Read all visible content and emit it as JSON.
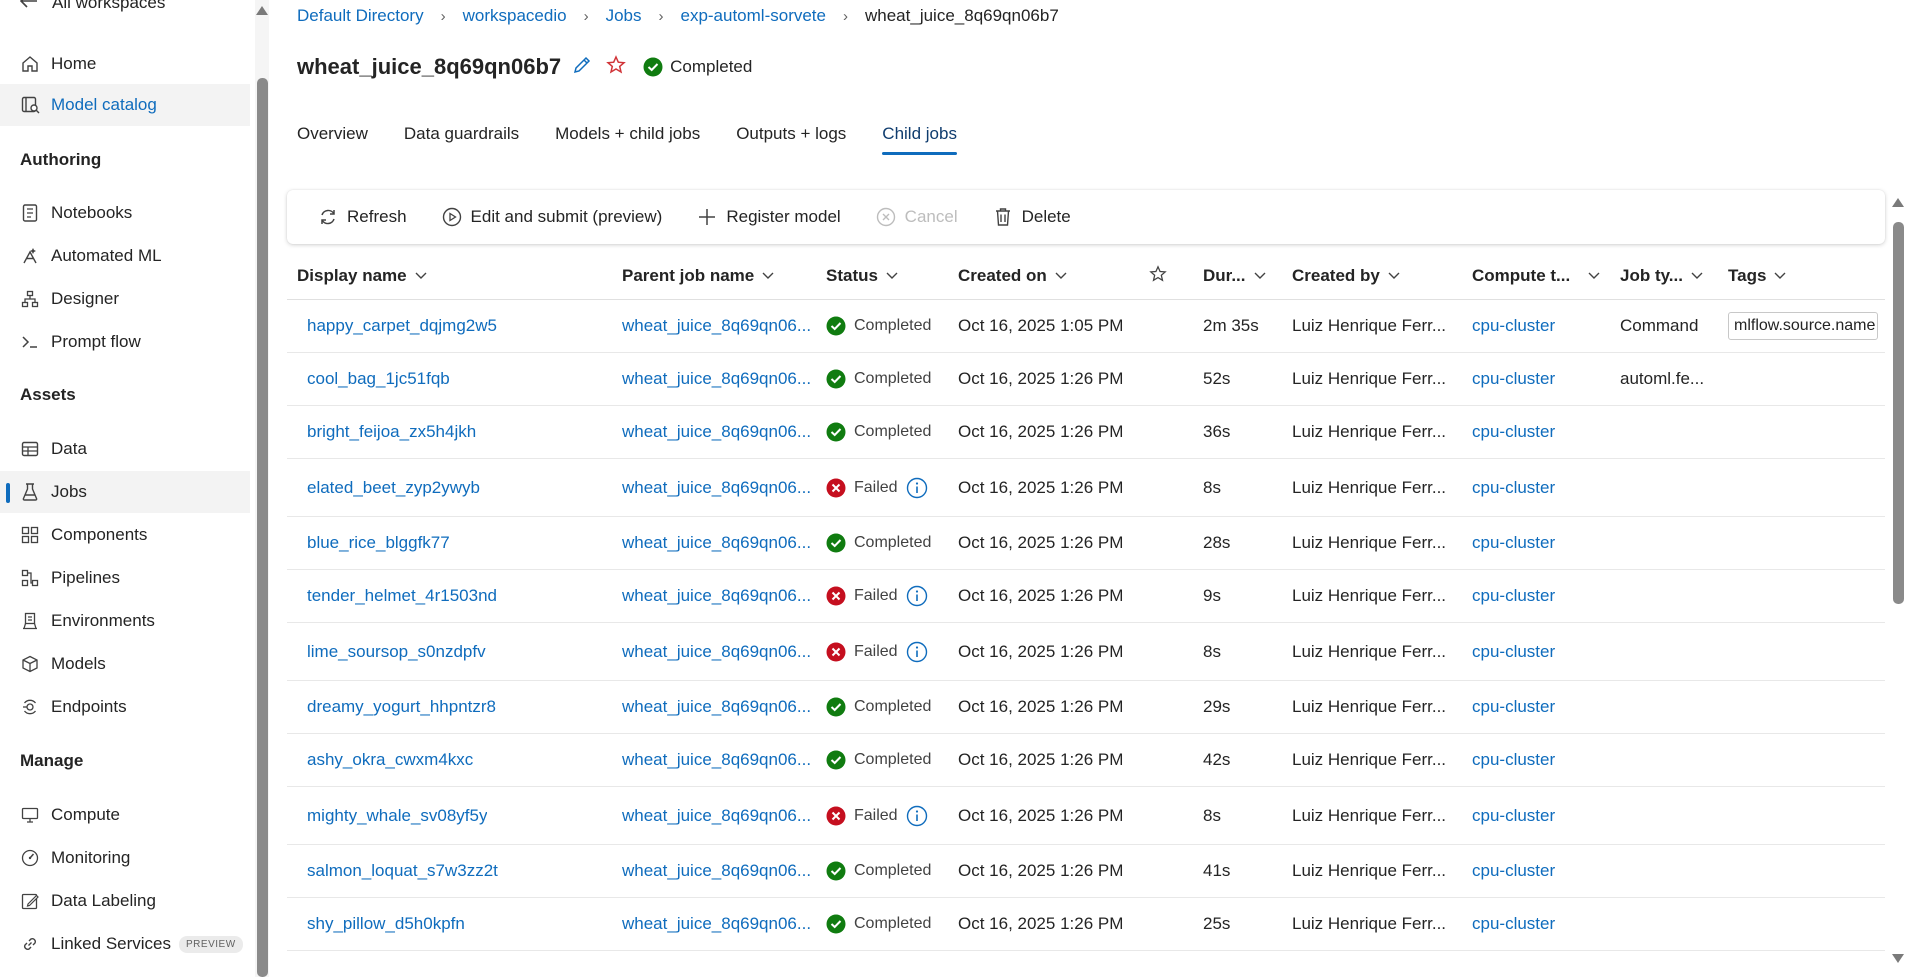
{
  "sidebar": {
    "back_label": "All workspaces",
    "items": [
      {
        "label": "Home",
        "icon": "home-icon"
      },
      {
        "label": "Model catalog",
        "icon": "catalog-icon"
      },
      {
        "label": "Notebooks",
        "icon": "notebook-icon"
      },
      {
        "label": "Automated ML",
        "icon": "automl-icon"
      },
      {
        "label": "Designer",
        "icon": "designer-icon"
      },
      {
        "label": "Prompt flow",
        "icon": "prompt-flow-icon"
      },
      {
        "label": "Data",
        "icon": "data-icon"
      },
      {
        "label": "Jobs",
        "icon": "flask-icon"
      },
      {
        "label": "Components",
        "icon": "components-icon"
      },
      {
        "label": "Pipelines",
        "icon": "pipelines-icon"
      },
      {
        "label": "Environments",
        "icon": "environments-icon"
      },
      {
        "label": "Models",
        "icon": "cube-icon"
      },
      {
        "label": "Endpoints",
        "icon": "endpoints-icon"
      },
      {
        "label": "Compute",
        "icon": "compute-icon"
      },
      {
        "label": "Monitoring",
        "icon": "monitoring-icon"
      },
      {
        "label": "Data Labeling",
        "icon": "labeling-icon"
      },
      {
        "label": "Linked Services",
        "icon": "link-icon",
        "badge": "PREVIEW"
      }
    ],
    "sections": {
      "authoring": "Authoring",
      "assets": "Assets",
      "manage": "Manage"
    }
  },
  "breadcrumb": {
    "items": [
      "Default Directory",
      "workspacedio",
      "Jobs",
      "exp-automl-sorvete"
    ],
    "current": "wheat_juice_8q69qn06b7"
  },
  "header": {
    "title": "wheat_juice_8q69qn06b7",
    "status": "Completed"
  },
  "tabs": [
    "Overview",
    "Data guardrails",
    "Models + child jobs",
    "Outputs + logs",
    "Child jobs"
  ],
  "active_tab": "Child jobs",
  "toolbar": {
    "refresh": "Refresh",
    "edit_submit": "Edit and submit (preview)",
    "register": "Register model",
    "cancel": "Cancel",
    "delete": "Delete"
  },
  "table": {
    "columns": {
      "display_name": "Display name",
      "parent_job": "Parent job name",
      "status": "Status",
      "created_on": "Created on",
      "duration": "Dur...",
      "created_by": "Created by",
      "compute": "Compute t...",
      "job_type": "Job ty...",
      "tags": "Tags"
    },
    "rows": [
      {
        "name": "happy_carpet_dqjmg2w5",
        "parent": "wheat_juice_8q69qn06...",
        "status": "Completed",
        "created": "Oct 16, 2025 1:05 PM",
        "duration": "2m 35s",
        "created_by": "Luiz Henrique Ferr...",
        "compute": "cpu-cluster",
        "job_type": "Command",
        "tags": "mlflow.source.name"
      },
      {
        "name": "cool_bag_1jc51fqb",
        "parent": "wheat_juice_8q69qn06...",
        "status": "Completed",
        "created": "Oct 16, 2025 1:26 PM",
        "duration": "52s",
        "created_by": "Luiz Henrique Ferr...",
        "compute": "cpu-cluster",
        "job_type": "automl.fe...",
        "tags": ""
      },
      {
        "name": "bright_feijoa_zx5h4jkh",
        "parent": "wheat_juice_8q69qn06...",
        "status": "Completed",
        "created": "Oct 16, 2025 1:26 PM",
        "duration": "36s",
        "created_by": "Luiz Henrique Ferr...",
        "compute": "cpu-cluster",
        "job_type": "",
        "tags": ""
      },
      {
        "name": "elated_beet_zyp2ywyb",
        "parent": "wheat_juice_8q69qn06...",
        "status": "Failed",
        "created": "Oct 16, 2025 1:26 PM",
        "duration": "8s",
        "created_by": "Luiz Henrique Ferr...",
        "compute": "cpu-cluster",
        "job_type": "",
        "tags": ""
      },
      {
        "name": "blue_rice_blggfk77",
        "parent": "wheat_juice_8q69qn06...",
        "status": "Completed",
        "created": "Oct 16, 2025 1:26 PM",
        "duration": "28s",
        "created_by": "Luiz Henrique Ferr...",
        "compute": "cpu-cluster",
        "job_type": "",
        "tags": ""
      },
      {
        "name": "tender_helmet_4r1503nd",
        "parent": "wheat_juice_8q69qn06...",
        "status": "Failed",
        "created": "Oct 16, 2025 1:26 PM",
        "duration": "9s",
        "created_by": "Luiz Henrique Ferr...",
        "compute": "cpu-cluster",
        "job_type": "",
        "tags": ""
      },
      {
        "name": "lime_soursop_s0nzdpfv",
        "parent": "wheat_juice_8q69qn06...",
        "status": "Failed",
        "created": "Oct 16, 2025 1:26 PM",
        "duration": "8s",
        "created_by": "Luiz Henrique Ferr...",
        "compute": "cpu-cluster",
        "job_type": "",
        "tags": ""
      },
      {
        "name": "dreamy_yogurt_hhpntzr8",
        "parent": "wheat_juice_8q69qn06...",
        "status": "Completed",
        "created": "Oct 16, 2025 1:26 PM",
        "duration": "29s",
        "created_by": "Luiz Henrique Ferr...",
        "compute": "cpu-cluster",
        "job_type": "",
        "tags": ""
      },
      {
        "name": "ashy_okra_cwxm4kxc",
        "parent": "wheat_juice_8q69qn06...",
        "status": "Completed",
        "created": "Oct 16, 2025 1:26 PM",
        "duration": "42s",
        "created_by": "Luiz Henrique Ferr...",
        "compute": "cpu-cluster",
        "job_type": "",
        "tags": ""
      },
      {
        "name": "mighty_whale_sv08yf5y",
        "parent": "wheat_juice_8q69qn06...",
        "status": "Failed",
        "created": "Oct 16, 2025 1:26 PM",
        "duration": "8s",
        "created_by": "Luiz Henrique Ferr...",
        "compute": "cpu-cluster",
        "job_type": "",
        "tags": ""
      },
      {
        "name": "salmon_loquat_s7w3zz2t",
        "parent": "wheat_juice_8q69qn06...",
        "status": "Completed",
        "created": "Oct 16, 2025 1:26 PM",
        "duration": "41s",
        "created_by": "Luiz Henrique Ferr...",
        "compute": "cpu-cluster",
        "job_type": "",
        "tags": ""
      },
      {
        "name": "shy_pillow_d5h0kpfn",
        "parent": "wheat_juice_8q69qn06...",
        "status": "Completed",
        "created": "Oct 16, 2025 1:26 PM",
        "duration": "25s",
        "created_by": "Luiz Henrique Ferr...",
        "compute": "cpu-cluster",
        "job_type": "",
        "tags": ""
      }
    ]
  },
  "colors": {
    "accent": "#0f6cbd",
    "success": "#107c10",
    "danger": "#c50f1f",
    "favorite": "#d13438"
  }
}
